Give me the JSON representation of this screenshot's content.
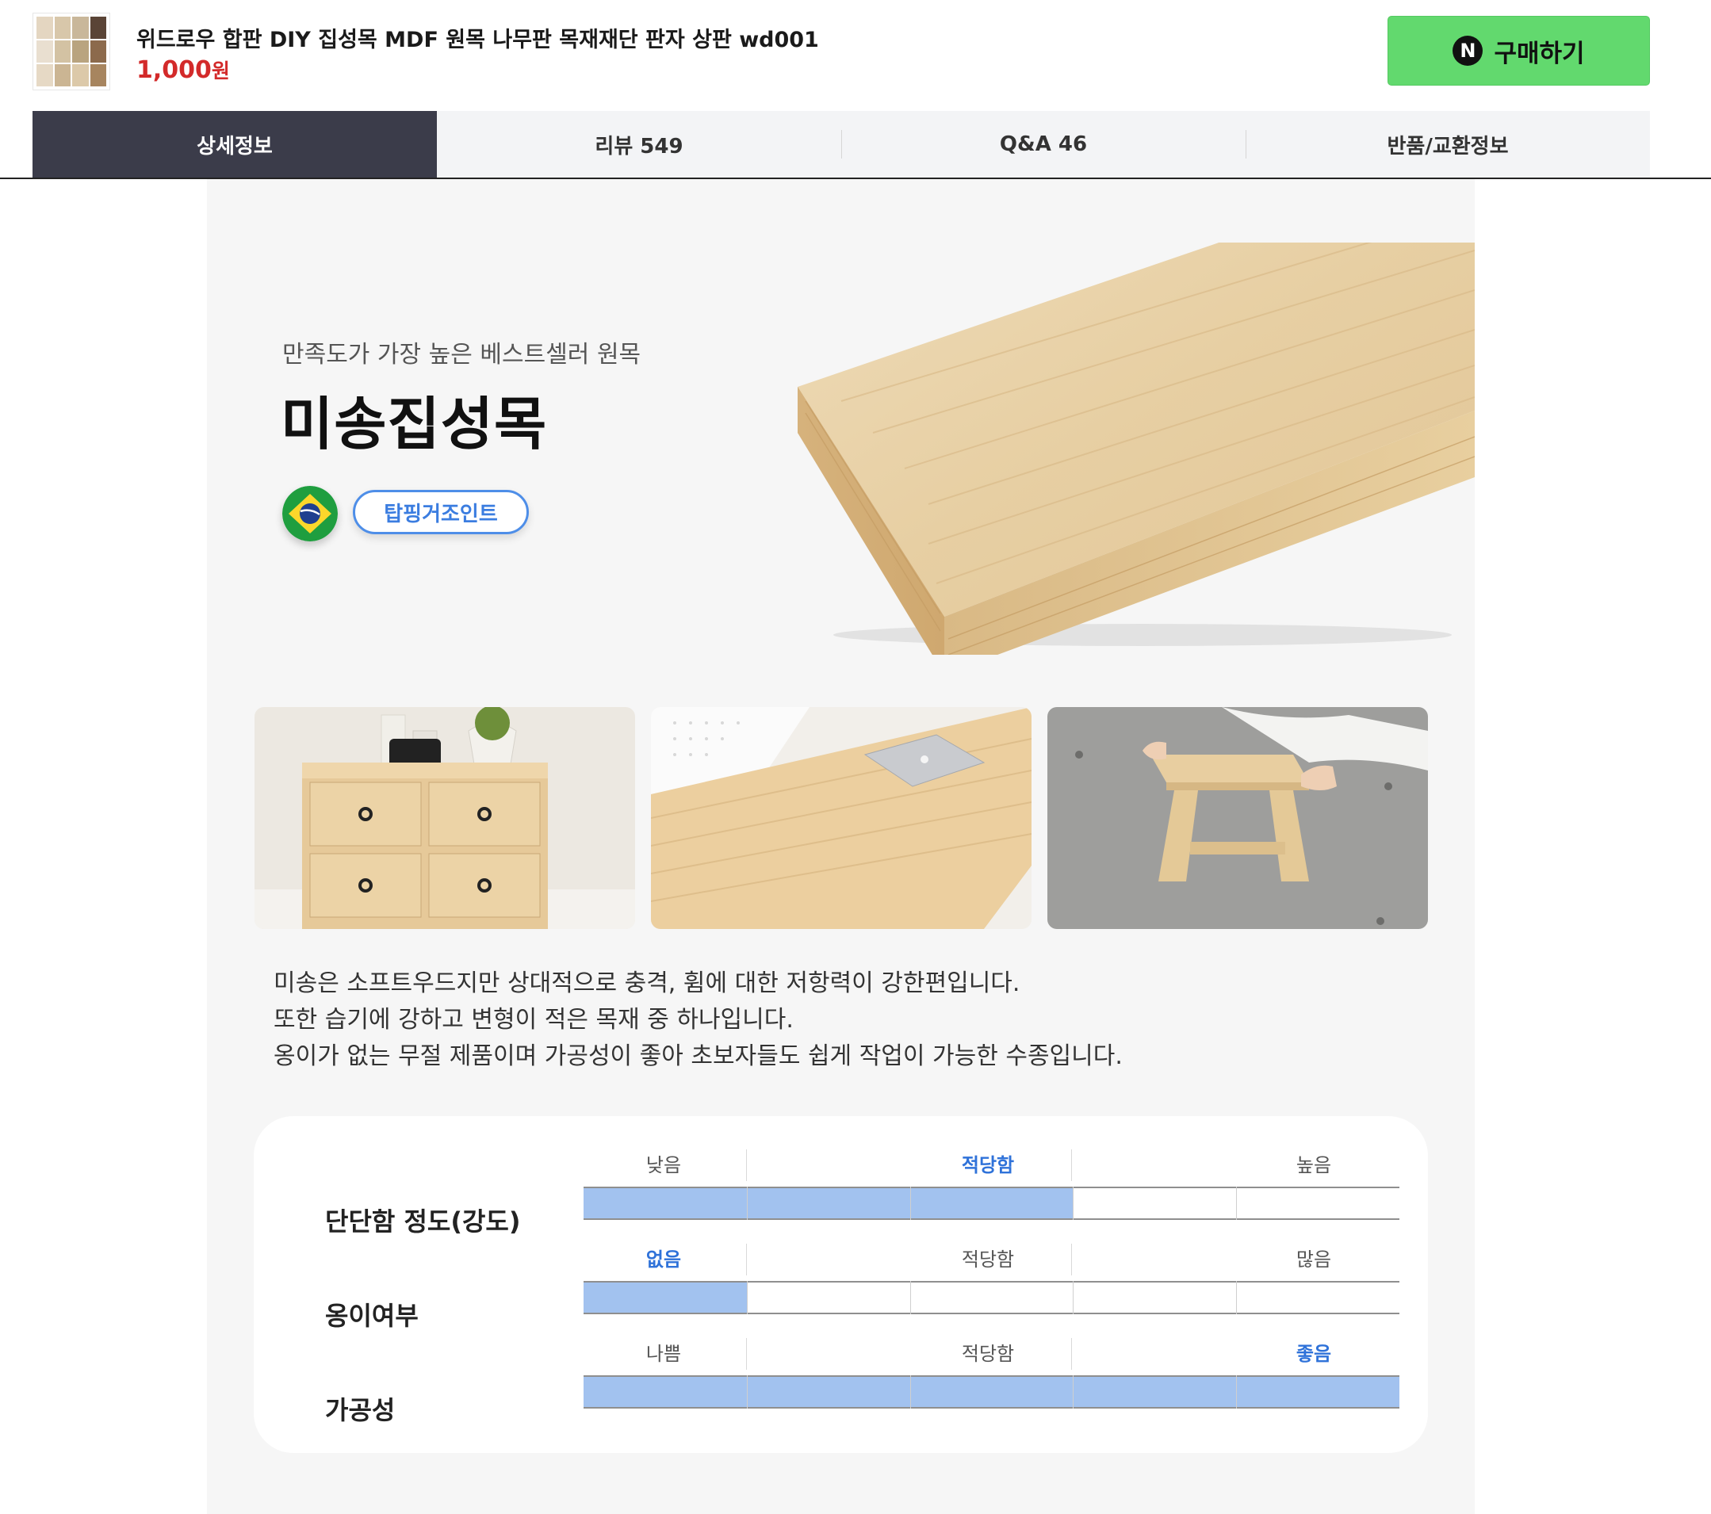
{
  "header": {
    "product_title": "위드로우 합판 DIY 집성목 MDF 원목 나무판 목재재단 판자 상판 wd001",
    "price": "1,000",
    "price_unit": "원",
    "buy_label": "구매하기",
    "naver_badge": "N"
  },
  "tabs": [
    {
      "label": "상세정보",
      "active": true
    },
    {
      "label": "리뷰 549",
      "active": false
    },
    {
      "label": "Q&A 46",
      "active": false
    },
    {
      "label": "반품/교환정보",
      "active": false
    }
  ],
  "hero": {
    "subtitle": "만족도가 가장 높은 베스트셀러 원목",
    "title": "미송집성목",
    "joint_badge": "탑핑거조인트",
    "flag_icon": "brazil-flag-icon"
  },
  "description": [
    "미송은 소프트우드지만 상대적으로 충격, 휨에 대한 저항력이 강한편입니다.",
    "또한 습기에 강하고 변형이 적은 목재 중 하나입니다.",
    "옹이가 없는 무절 제품이며 가공성이 좋아 초보자들도 쉽게 작업이 가능한 수종입니다."
  ],
  "specs": [
    {
      "label": "단단함 정도(강도)",
      "scale": [
        "낮음",
        "적당함",
        "높음"
      ],
      "highlight": 1,
      "level": 0.6
    },
    {
      "label": "옹이여부",
      "scale": [
        "없음",
        "적당함",
        "많음"
      ],
      "highlight": 0,
      "level": 0.2
    },
    {
      "label": "가공성",
      "scale": [
        "나쁨",
        "적당함",
        "좋음"
      ],
      "highlight": 2,
      "level": 1.0
    }
  ],
  "colors": {
    "accent_blue": "#2f72d9",
    "bar_fill": "#a2c2ef",
    "buy_green": "#62d96e",
    "price_red": "#d32a2a",
    "active_tab": "#3b3c4a"
  }
}
